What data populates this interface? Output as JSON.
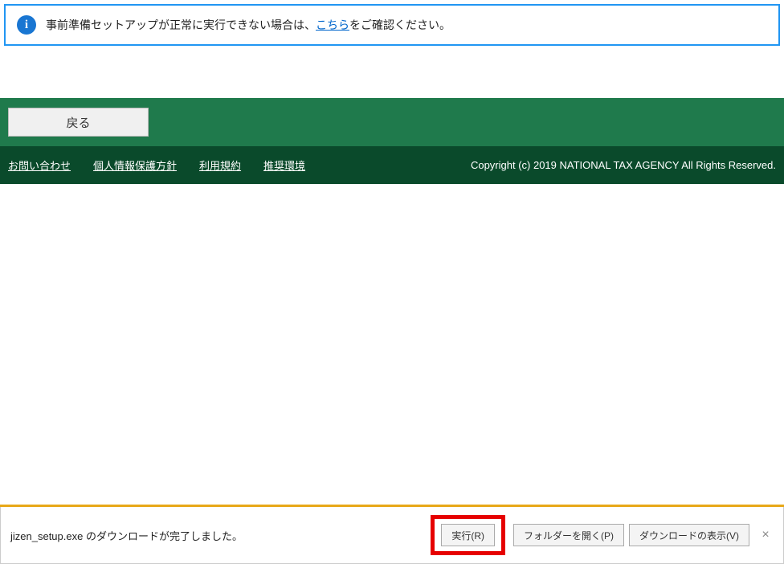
{
  "info": {
    "icon_glyph": "i",
    "text_before": "事前準備セットアップが正常に実行できない場合は、",
    "link_text": "こちら",
    "text_after": "をご確認ください。"
  },
  "nav": {
    "back_label": "戻る"
  },
  "footer": {
    "links": {
      "contact": "お問い合わせ",
      "privacy": "個人情報保護方針",
      "terms": "利用規約",
      "environment": "推奨環境"
    },
    "copyright": "Copyright (c) 2019 NATIONAL TAX AGENCY All Rights Reserved."
  },
  "download": {
    "message": "jizen_setup.exe のダウンロードが完了しました。",
    "run_label": "実行(R)",
    "open_folder_label": "フォルダーを開く(P)",
    "show_downloads_label": "ダウンロードの表示(V)"
  }
}
